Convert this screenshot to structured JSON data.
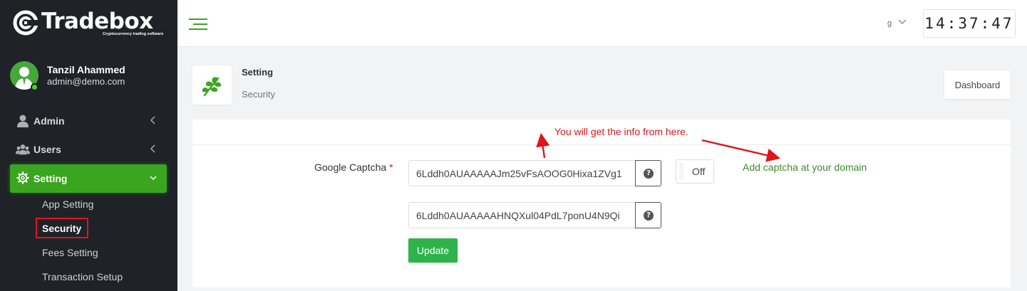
{
  "brand": {
    "name_part1": "Trade",
    "name_part2": "box",
    "tagline": "Cryptocurrency trading software",
    "accent_color": "#3aa51f"
  },
  "user": {
    "name": "Tanzil Ahammed",
    "email": "admin@demo.com"
  },
  "sidebar": {
    "items": [
      {
        "label": "Admin",
        "icon": "user-icon"
      },
      {
        "label": "Users",
        "icon": "users-icon"
      },
      {
        "label": "Setting",
        "icon": "gear-icon"
      }
    ],
    "subitems": [
      {
        "label": "App Setting"
      },
      {
        "label": "Security"
      },
      {
        "label": "Fees Setting"
      },
      {
        "label": "Transaction Setup"
      }
    ]
  },
  "topbar": {
    "lang": "g",
    "clock": "14:37:47"
  },
  "page": {
    "title": "Setting",
    "subtitle": "Security",
    "dashboard_button": "Dashboard"
  },
  "form": {
    "captcha_label": "Google Captcha",
    "required_mark": "*",
    "site_key": "6Lddh0AUAAAAAJm25vFsAOOG0Hixa1ZVg1",
    "secret_key": "6Lddh0AUAAAAAHNQXul04PdL7ponU4N9Qi",
    "help_glyph": "?",
    "toggle_label": "Off",
    "domain_link": "Add captcha at your domain",
    "update_button": "Update"
  },
  "annotation": {
    "text": "You will get the info from here."
  }
}
